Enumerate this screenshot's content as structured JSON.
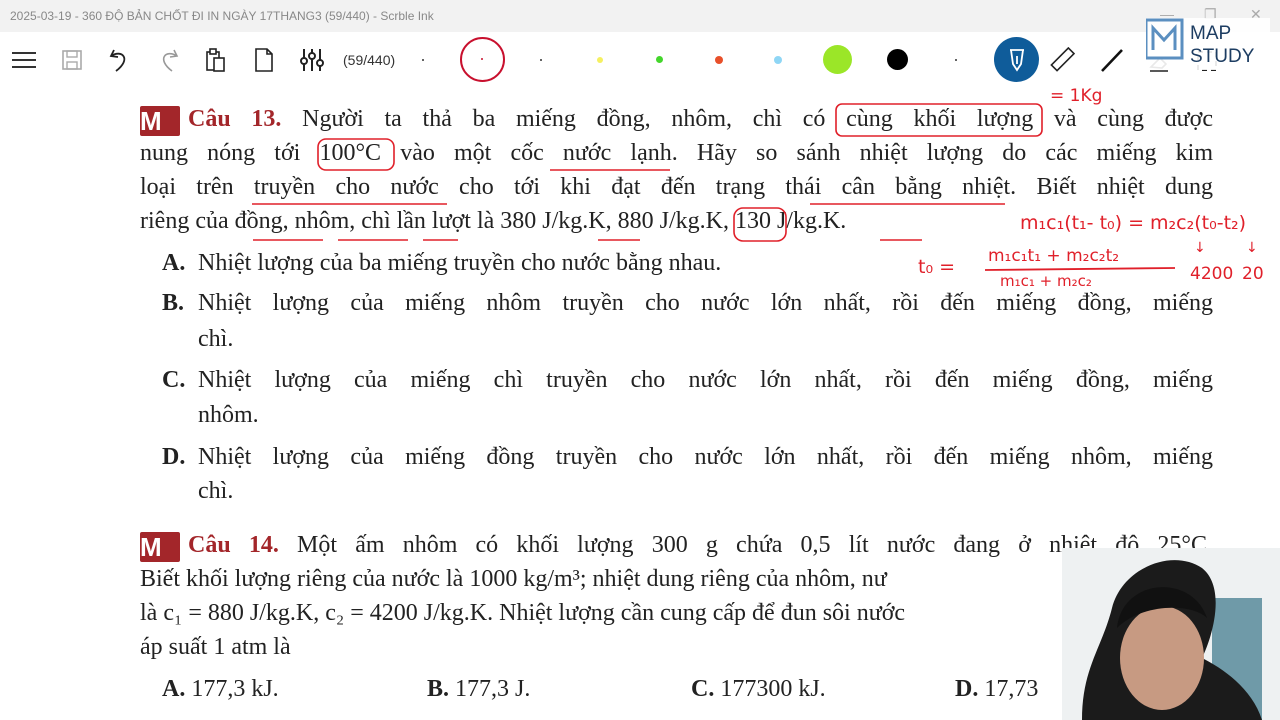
{
  "window": {
    "title": "2025-03-19 - 360 ĐỘ BẢN CHỐT ĐI IN NGÀY 17THANG3 (59/440) - Scrble Ink",
    "minimize": "—",
    "maximize": "❐",
    "close": "✕"
  },
  "toolbar": {
    "page_count": "(59/440)",
    "colors": {
      "accent_pen": "#0f5c9a",
      "lime": "#9be628",
      "green": "#44d62c",
      "orange": "#e8502a",
      "lightblue": "#8fd6f5",
      "yellow": "#f5f060",
      "red_ring": "#c8102e",
      "black": "#000000"
    }
  },
  "brand": {
    "line1": "MAP",
    "line2": "STUDY"
  },
  "q13": {
    "label": "Câu 13.",
    "lines": [
      "Người ta thả ba miếng đồng, nhôm, chì có cùng khối lượng và cùng được",
      "nung nóng tới 100°C vào một cốc nước lạnh. Hãy so sánh nhiệt lượng do các miếng kim",
      "loại trên truyền cho nước cho tới khi đạt đến trạng thái cân bằng nhiệt. Biết nhiệt dung",
      "riêng của đồng, nhôm, chì lần lượt là 380 J/kg.K, 880 J/kg.K, 130 J/kg.K."
    ],
    "options": [
      {
        "k": "A.",
        "t": "Nhiệt lượng của ba miếng truyền cho nước bằng nhau."
      },
      {
        "k": "B.",
        "t": "Nhiệt lượng của miếng nhôm truyền cho nước lớn nhất, rồi đến miếng đồng, miếng",
        "t2": "chì."
      },
      {
        "k": "C.",
        "t": "Nhiệt lượng của miếng chì truyền cho nước lớn nhất, rồi đến miếng đồng, miếng",
        "t2": "nhôm."
      },
      {
        "k": "D.",
        "t": "Nhiệt lượng của miếng đồng truyền cho nước lớn nhất, rồi đến miếng nhôm, miếng",
        "t2": "chì."
      }
    ]
  },
  "q14": {
    "label": "Câu 14.",
    "lines": [
      "Một ấm nhôm có khối lượng 300 g chứa 0,5 lít nước đang ở nhiệt độ 25°C.",
      "Biết khối lượng riêng của nước là 1000 kg/m³; nhiệt dung riêng của nhôm, nư",
      "là c₁ = 880 J/kg.K, c₂ = 4200 J/kg.K. Nhiệt lượng cần cung cấp để đun sôi nước",
      "áp suất 1 atm là"
    ],
    "options": [
      {
        "k": "A.",
        "t": "177,3 kJ."
      },
      {
        "k": "B.",
        "t": "177,3 J."
      },
      {
        "k": "C.",
        "t": "177300 kJ."
      },
      {
        "k": "D.",
        "t": "17,73"
      }
    ]
  },
  "ink": {
    "mass_note": "= 1Kg",
    "eq1": "m₁c₁(t₁- t₀) = m₂c₂(t₀-t₂)",
    "t0": "t₀ =",
    "num": "m₁c₁t₁ + m₂c₂t₂",
    "den": "m₁c₁ + m₂c₂",
    "v1": "4200",
    "v2": "20",
    "arrow": "↓"
  }
}
